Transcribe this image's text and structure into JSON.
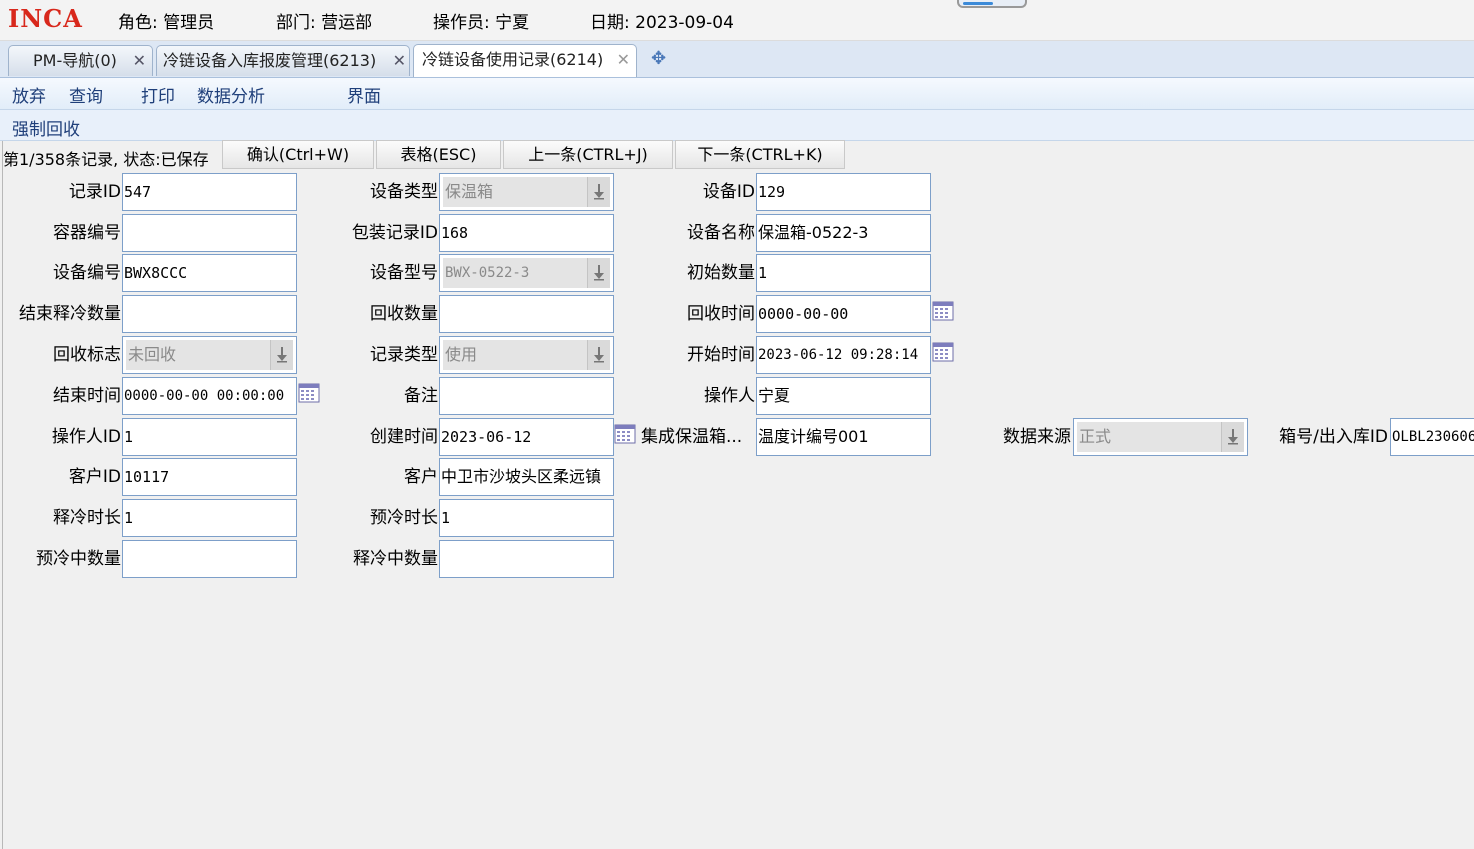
{
  "header": {
    "logo": "INCA",
    "role": "角色: 管理员",
    "department": "部门: 营运部",
    "operator": "操作员: 宁夏",
    "date": "日期: 2023-09-04"
  },
  "tabs": [
    {
      "label": "PM-导航(0)"
    },
    {
      "label": "冷链设备入库报废管理(6213)"
    },
    {
      "label": "冷链设备使用记录(6214)"
    }
  ],
  "menu": {
    "discard": "放弃",
    "query": "查询",
    "print": "打印",
    "analysis": "数据分析",
    "interface": "界面",
    "force_recycle": "强制回收"
  },
  "toolbar": {
    "status": "第1/358条记录, 状态:已保存",
    "confirm": "确认(Ctrl+W)",
    "table": "表格(ESC)",
    "prev": "上一条(CTRL+J)",
    "next": "下一条(CTRL+K)"
  },
  "form": {
    "record_id": {
      "label": "记录ID",
      "value": "547"
    },
    "container_no": {
      "label": "容器编号",
      "value": ""
    },
    "device_no": {
      "label": "设备编号",
      "value": "BWX8CCC"
    },
    "end_release_qty": {
      "label": "结束释冷数量",
      "value": ""
    },
    "recycle_flag": {
      "label": "回收标志",
      "value": "未回收"
    },
    "end_time": {
      "label": "结束时间",
      "value": "0000-00-00 00:00:00"
    },
    "operator_id": {
      "label": "操作人ID",
      "value": "1"
    },
    "customer_id": {
      "label": "客户ID",
      "value": "10117"
    },
    "release_duration": {
      "label": "释冷时长",
      "value": "1"
    },
    "precool_qty": {
      "label": "预冷中数量",
      "value": ""
    },
    "device_type": {
      "label": "设备类型",
      "value": "保温箱"
    },
    "package_record_id": {
      "label": "包装记录ID",
      "value": "168"
    },
    "device_model": {
      "label": "设备型号",
      "value": "BWX-0522-3"
    },
    "recycle_qty": {
      "label": "回收数量",
      "value": ""
    },
    "record_type": {
      "label": "记录类型",
      "value": "使用"
    },
    "remark": {
      "label": "备注",
      "value": ""
    },
    "create_time": {
      "label": "创建时间",
      "value": "2023-06-12"
    },
    "customer": {
      "label": "客户",
      "value": "中卫市沙坡头区柔远镇"
    },
    "precool_duration": {
      "label": "预冷时长",
      "value": "1"
    },
    "releasing_qty": {
      "label": "释冷中数量",
      "value": ""
    },
    "device_id": {
      "label": "设备ID",
      "value": "129"
    },
    "device_name": {
      "label": "设备名称",
      "value": "保温箱-0522-3"
    },
    "initial_qty": {
      "label": "初始数量",
      "value": "1"
    },
    "recycle_time": {
      "label": "回收时间",
      "value": "0000-00-00"
    },
    "start_time": {
      "label": "开始时间",
      "value": "2023-06-12 09:28:14"
    },
    "operator": {
      "label": "操作人",
      "value": "宁夏"
    },
    "integrated_box": {
      "label": "集成保温箱...",
      "value": "温度计编号001"
    },
    "data_source": {
      "label": "数据来源",
      "value": "正式"
    },
    "box_io_id": {
      "label": "箱号/出入库ID",
      "value": "OLBL230606"
    }
  },
  "colors": {
    "logo": "#d8281c",
    "field_border": "#7d9fc9",
    "menu_text": "#1f3f7a",
    "tab_strip": "#dde7f4"
  }
}
